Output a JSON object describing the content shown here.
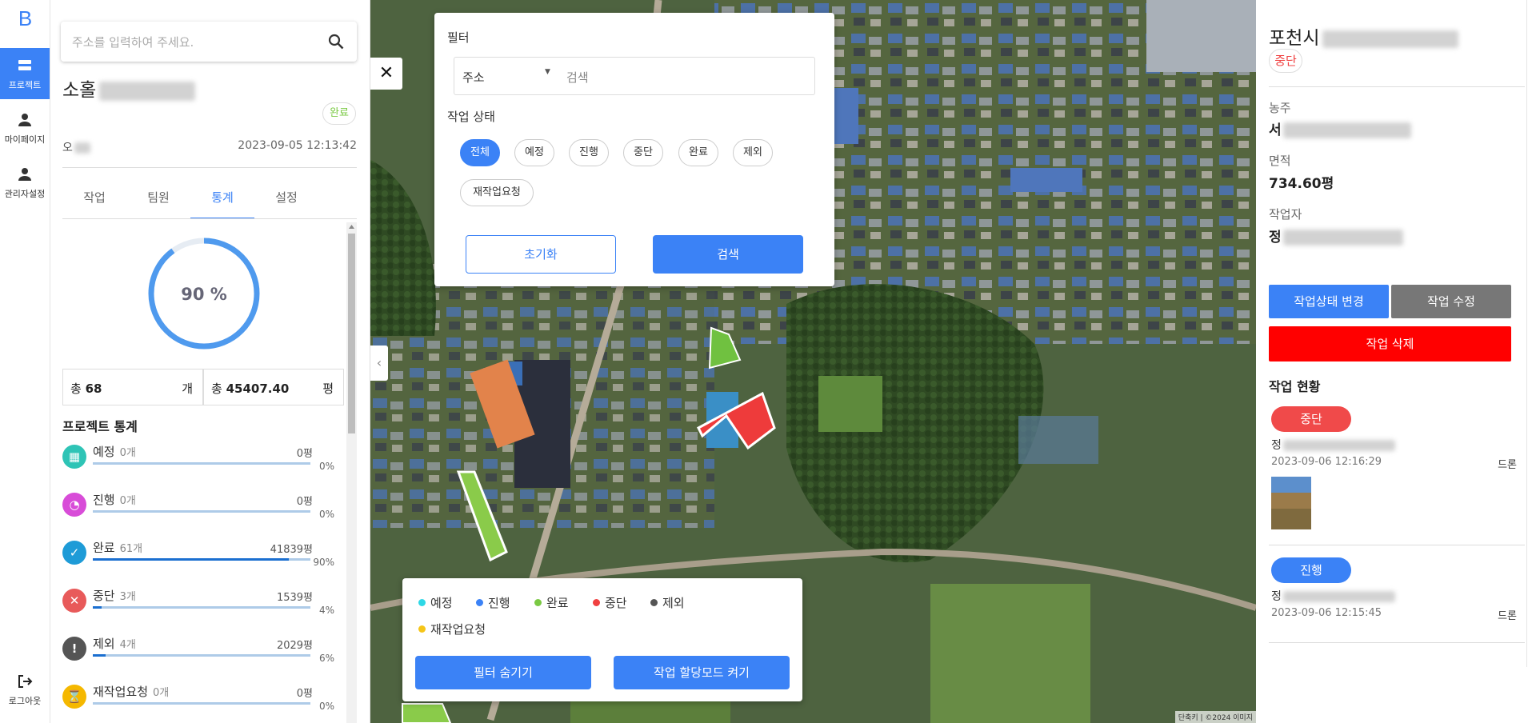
{
  "nav": {
    "logo": "B",
    "items": [
      {
        "label": "프로젝트",
        "icon": "list-icon"
      },
      {
        "label": "마이페이지",
        "icon": "person-icon"
      },
      {
        "label": "관리자설정",
        "icon": "person-icon"
      }
    ],
    "logout": "로그아웃"
  },
  "search": {
    "placeholder": "주소를 입력하여 주세요."
  },
  "project": {
    "title_visible": "소홀",
    "status": "완료",
    "owner_visible": "오",
    "date": "2023-09-05 12:13:42",
    "tabs": [
      "작업",
      "팀원",
      "통계",
      "설정"
    ],
    "active_tab": "통계",
    "progress": {
      "value": 90,
      "label": "90 %"
    },
    "count": {
      "prefix": "총",
      "value": "68",
      "unit": "개"
    },
    "area": {
      "prefix": "총",
      "value": "45407.40",
      "unit": "평"
    },
    "stats_title": "프로젝트 통계",
    "stats": [
      {
        "name": "예정",
        "count": "0개",
        "area": "0평",
        "pct": "0%",
        "fraction": 0,
        "color": "#2ec4b6"
      },
      {
        "name": "진행",
        "count": "0개",
        "area": "0평",
        "pct": "0%",
        "fraction": 0,
        "color": "#d84cd8"
      },
      {
        "name": "완료",
        "count": "61개",
        "area": "41839평",
        "pct": "90%",
        "fraction": 0.9,
        "color": "#1e9bd7"
      },
      {
        "name": "중단",
        "count": "3개",
        "area": "1539평",
        "pct": "4%",
        "fraction": 0.04,
        "color": "#e85a5a"
      },
      {
        "name": "제외",
        "count": "4개",
        "area": "2029평",
        "pct": "6%",
        "fraction": 0.06,
        "color": "#555555"
      },
      {
        "name": "재작업요청",
        "count": "0개",
        "area": "0평",
        "pct": "0%",
        "fraction": 0,
        "color": "#f5b800"
      }
    ]
  },
  "filter": {
    "title": "필터",
    "select_value": "주소",
    "search_placeholder": "검색",
    "status_label": "작업 상태",
    "chips": [
      "전체",
      "예정",
      "진행",
      "중단",
      "완료",
      "제외",
      "재작업요청"
    ],
    "active_chip": "전체",
    "reset": "초기화",
    "submit": "검색"
  },
  "legend": {
    "items": [
      {
        "label": "예정",
        "color": "#2ed8e6"
      },
      {
        "label": "진행",
        "color": "#3b82f6"
      },
      {
        "label": "완료",
        "color": "#7ac943"
      },
      {
        "label": "중단",
        "color": "#f04040"
      },
      {
        "label": "제외",
        "color": "#555555"
      },
      {
        "label": "재작업요청",
        "color": "#f5c518"
      }
    ],
    "hide_filter": "필터 숨기기",
    "assign_mode": "작업 할당모드 켜기"
  },
  "map_attribution": "단축키 | ©2024 이미지",
  "detail": {
    "title_visible": "포천시",
    "status": "중단",
    "farmer_label": "농주",
    "farmer_visible": "서",
    "area_label": "면적",
    "area_value": "734.60평",
    "worker_label": "작업자",
    "worker_visible": "정",
    "change_status": "작업상태 변경",
    "edit": "작업 수정",
    "delete": "작업 삭제",
    "history_title": "작업 현황",
    "history": [
      {
        "status": "중단",
        "name_visible": "정",
        "date": "2023-09-06 12:16:29",
        "type": "드론",
        "color": "#f04a4a"
      },
      {
        "status": "진행",
        "name_visible": "정",
        "date": "2023-09-06 12:15:45",
        "type": "드론",
        "color": "#3b82f6"
      }
    ]
  },
  "colors": {
    "accent": "#3b82f6",
    "danger": "#ff0000",
    "gray_button": "#777777"
  }
}
